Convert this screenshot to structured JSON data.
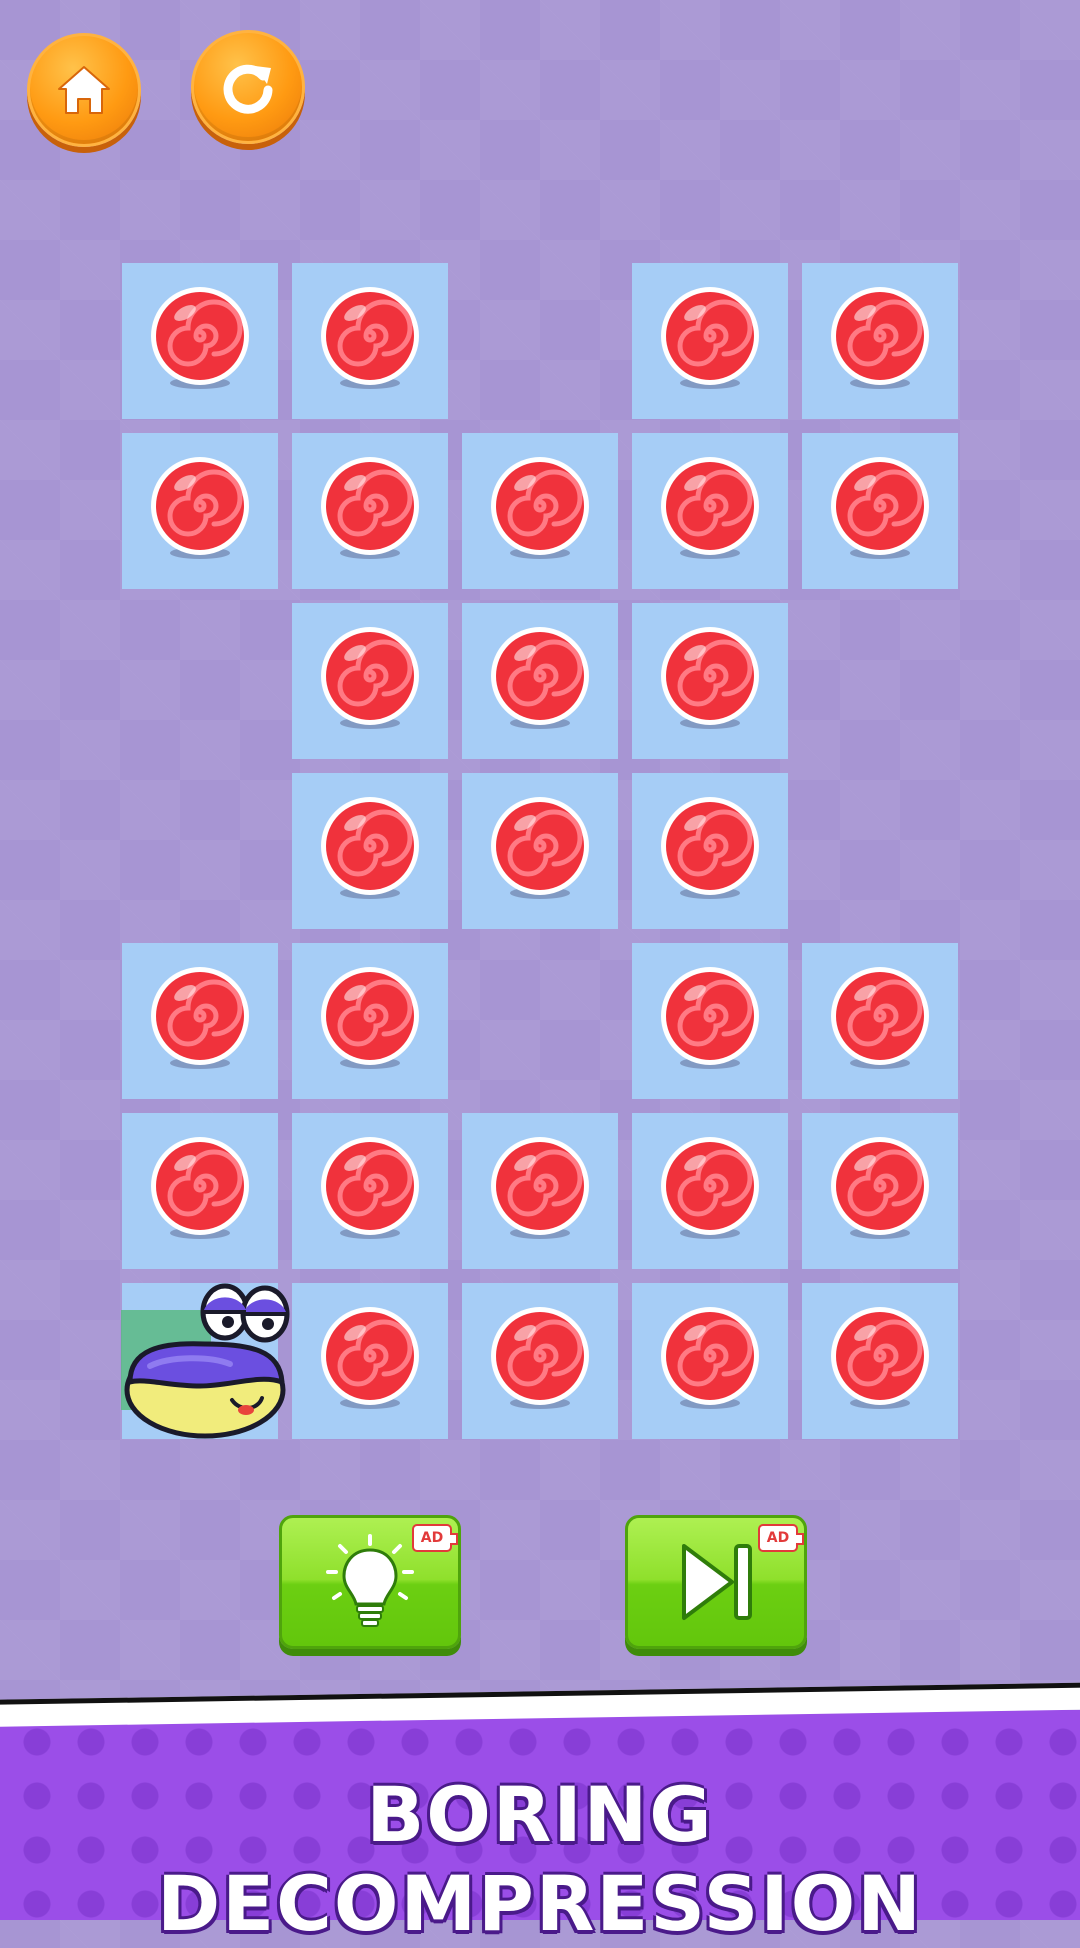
{
  "toolbar": {
    "home_icon": "home-icon",
    "restart_icon": "restart-icon"
  },
  "board": {
    "rows": [
      [
        1,
        1,
        0,
        1,
        1
      ],
      [
        1,
        1,
        1,
        1,
        1
      ],
      [
        0,
        1,
        1,
        1,
        0
      ],
      [
        0,
        1,
        1,
        1,
        0
      ],
      [
        1,
        1,
        0,
        1,
        1
      ],
      [
        1,
        1,
        1,
        1,
        1
      ],
      [
        2,
        1,
        1,
        1,
        1
      ]
    ],
    "legend": {
      "0": "empty",
      "1": "candy",
      "2": "player"
    },
    "colors": {
      "tile": "#a6cdf6",
      "candy": "#f0323c",
      "player_body": "#6b4fe0",
      "player_belly": "#f1ec7c"
    }
  },
  "actions": {
    "hint": {
      "icon": "lightbulb-icon",
      "badge": "AD"
    },
    "skip": {
      "icon": "skip-icon",
      "badge": "AD"
    }
  },
  "banner": {
    "title": "BORING DECOMPRESSION",
    "colors": {
      "background": "#9b4ee8",
      "text": "#ffffff"
    }
  }
}
